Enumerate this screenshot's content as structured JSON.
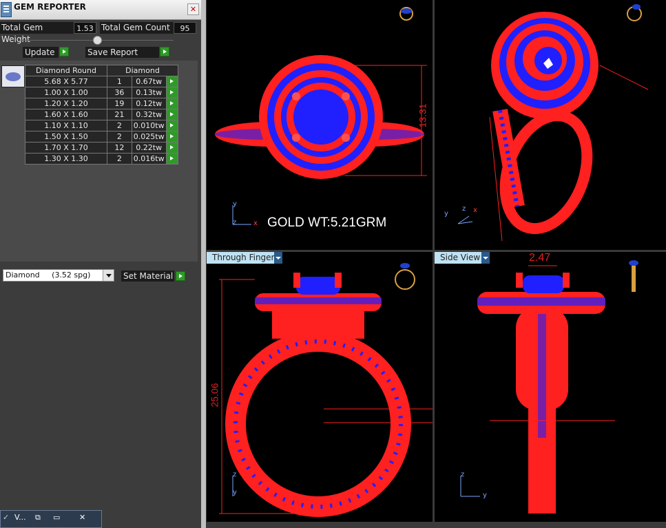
{
  "window": {
    "title": "GEM REPORTER",
    "close_glyph": "✕"
  },
  "stats": {
    "total_gem_weight_label": "Total Gem Weight",
    "total_gem_weight_value": "1.53",
    "total_gem_count_label": "Total Gem Count",
    "total_gem_count_value": "95"
  },
  "buttons": {
    "update": "Update",
    "save_report": "Save Report",
    "set_material": "Set Material"
  },
  "gem_table": {
    "headers": [
      "Diamond Round",
      "Diamond"
    ],
    "rows": [
      {
        "size": "5.68 X 5.77",
        "count": "1",
        "weight": "0.67tw"
      },
      {
        "size": "1.00 X 1.00",
        "count": "36",
        "weight": "0.13tw"
      },
      {
        "size": "1.20 X 1.20",
        "count": "19",
        "weight": "0.12tw"
      },
      {
        "size": "1.60 X 1.60",
        "count": "21",
        "weight": "0.32tw"
      },
      {
        "size": "1.10 X 1.10",
        "count": "2",
        "weight": "0.010tw"
      },
      {
        "size": "1.50 X 1.50",
        "count": "2",
        "weight": "0.025tw"
      },
      {
        "size": "1.70 X 1.70",
        "count": "12",
        "weight": "0.22tw"
      },
      {
        "size": "1.30 X 1.30",
        "count": "2",
        "weight": "0.016tw"
      }
    ]
  },
  "material": {
    "selected": "Diamond     (3.52 spg)"
  },
  "taskbar": {
    "label": "V..."
  },
  "viewports": {
    "top_left": {
      "annotation": "GOLD WT:5.21GRM",
      "dimension": "13.31"
    },
    "bottom_left": {
      "tab": "Through Finger",
      "dimension": "25.06"
    },
    "bottom_right": {
      "tab": "Side View",
      "dimension": "2.47"
    }
  },
  "axes": {
    "x": "x",
    "y": "y",
    "z": "z"
  },
  "colors": {
    "metal": "#ff2020",
    "gems": "#2020ff",
    "viewport_bg": "#000000",
    "tab_bg": "#bfe2f4"
  }
}
